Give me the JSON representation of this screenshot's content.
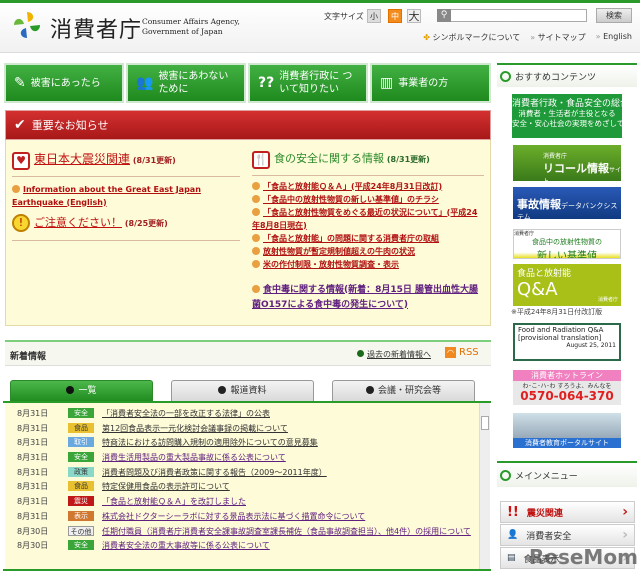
{
  "header": {
    "logo_jp": "消費者庁",
    "logo_en_1": "Consumer Affairs Agency,",
    "logo_en_2": "Government of Japan",
    "font_size_label": "文字サイズ",
    "font_sizes": [
      "小",
      "中",
      "大"
    ],
    "search_button": "検索",
    "links": [
      "シンボルマークについて",
      "サイトマップ",
      "English"
    ]
  },
  "nav": [
    {
      "label": "被害にあったら",
      "icon": "✎"
    },
    {
      "label": "被害にあわない ために",
      "icon": "👥"
    },
    {
      "label": "消費者行政に ついて知りたい",
      "icon": "??"
    },
    {
      "label": "事業者の方",
      "icon": "▥"
    }
  ],
  "notice": {
    "title": "重要なお知らせ",
    "left": {
      "head1": "東日本大震災関連",
      "head1_date": "(8/31更新)",
      "link_en": "Information about the Great East Japan Earthquake (English)",
      "head2": "ご注意ください！",
      "head2_date": "(8/25更新)"
    },
    "right": {
      "head": "食の安全に関する情報",
      "head_date": "(8/31更新)",
      "links": [
        "「食品と放射能Ｑ＆Ａ」(平成24年8月31日改訂)",
        "「食品中の放射性物質の新しい基準値」のチラシ",
        "「食品と放射性物質をめぐる最近の状況について」(平成24年8月8日現在)",
        "「食品と放射能」の問題に関する消費者庁の取組",
        "放射性物質が暫定規制値超えの牛肉の状況",
        "米の作付制限・放射性物質調査・表示"
      ],
      "poison": "食中毒に関する情報(新着：8月15日 腸管出血性大腸菌O157による食中毒の発生について)"
    }
  },
  "news": {
    "title": "新着情報",
    "past_link": "過去の新着情報へ",
    "rss": "RSS",
    "tabs": [
      "一覧",
      "報道資料",
      "会議・研究会等"
    ],
    "items": [
      {
        "date": "8月31日",
        "tag": "安全",
        "title": "「消費者安全法の一部を改正する法律」の公表"
      },
      {
        "date": "8月31日",
        "tag": "食品",
        "title": "第12回食品表示一元化検討会議事録の掲載について"
      },
      {
        "date": "8月31日",
        "tag": "取引",
        "title": "特商法における訪問購入規制の適用除外についての意見募集"
      },
      {
        "date": "8月31日",
        "tag": "安全",
        "title": "消費生活用製品の重大製品事故に係る公表について"
      },
      {
        "date": "8月31日",
        "tag": "政策",
        "title": "消費者問題及び消費者政策に関する報告（2009～2011年度）"
      },
      {
        "date": "8月31日",
        "tag": "食品",
        "title": "特定保健用食品の表示許可について"
      },
      {
        "date": "8月31日",
        "tag": "震災",
        "title": "「食品と放射能Ｑ＆Ａ」を改訂しました"
      },
      {
        "date": "8月31日",
        "tag": "表示",
        "title": "株式会社ドクターシーラボに対する景品表示法に基づく措置命令について"
      },
      {
        "date": "8月30日",
        "tag": "その他",
        "title": "任期付職員（消費者庁消費者安全課事故調査室課長補佐（食品事故調査担当）、他4件）の採用について"
      },
      {
        "date": "8月30日",
        "tag": "安全",
        "title": "消費者安全法の重大事故等に係る公表について"
      }
    ]
  },
  "tag_colors": {
    "安全": "#3aa63a",
    "食品": "#e8c030",
    "取引": "#6aa8e0",
    "政策": "#8ad8c8",
    "震災": "#c01818",
    "表示": "#d07830",
    "その他": "#f0f0f0"
  },
  "sidebar": {
    "recommended_title": "おすすめコンテンツ",
    "banner1": {
      "title": "消費者行政・食品安全の総合案内",
      "line1": "消費者・生活者が主役となる",
      "line2": "安全・安心社会の実現をめざして"
    },
    "banner2": {
      "small": "消費者庁",
      "title": "リコール情報",
      "suffix": "サイト"
    },
    "banner3": {
      "title": "事故情報",
      "suffix": "データバンクシステム"
    },
    "banner4": {
      "small": "消費者庁",
      "line1": "食品中の放射性物質の",
      "line2": "新しい基準値"
    },
    "banner5": {
      "line1": "食品と放射能",
      "qa": "Q&A",
      "small": "消費者庁"
    },
    "banner5_note": "※平成24年8月31日付改訂版",
    "banner6": {
      "title": "Food and Radiation Q&A",
      "line2": "[provisional translation]",
      "date": "August 25, 2011"
    },
    "banner7": {
      "title": "消費者ホットライン",
      "line2": "わ･こ･ハ･わ すろうよ、みんなを",
      "phone": "0570-064-370"
    },
    "banner8": {
      "title": "消費者教育ポータルサイト"
    },
    "main_menu_title": "メインメニュー",
    "menu": [
      "震災関連",
      "消費者安全",
      "食品表示"
    ]
  },
  "watermark": "ReseMom"
}
